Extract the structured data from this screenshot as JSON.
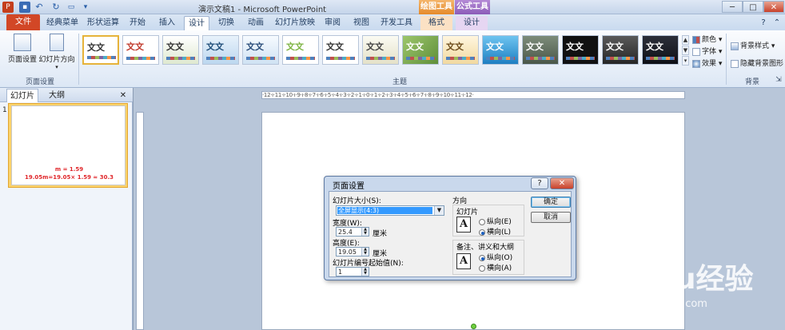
{
  "window": {
    "title": "演示文稿1 - Microsoft PowerPoint",
    "contextual_groups": [
      "绘图工具",
      "公式工具"
    ],
    "controls": [
      "─",
      "□",
      "✕"
    ]
  },
  "tabs": [
    "文件",
    "经典菜单",
    "形状运算",
    "开始",
    "插入",
    "设计",
    "切换",
    "动画",
    "幻灯片放映",
    "审阅",
    "视图",
    "开发工具",
    "格式",
    "设计"
  ],
  "ribbon": {
    "page_setup_group": {
      "label": "页面设置",
      "page_setup_btn": "页面设置",
      "orientation_btn": "幻灯片方向"
    },
    "themes_group": {
      "label": "主题",
      "theme_text": "文文"
    },
    "side_options": {
      "colors": "颜色",
      "fonts": "字体",
      "effects": "效果"
    },
    "background_group": {
      "label": "背景",
      "bg_styles": "背景样式",
      "hide_bg": "隐藏背景图形"
    }
  },
  "left_pane": {
    "tab_slides": "幻灯片",
    "tab_outline": "大纲",
    "close": "✕",
    "slide_number": "1",
    "thumb_line1": "m = 1.59",
    "thumb_line2": "19.05m=19.05× 1.59 ≈ 30.3"
  },
  "ruler": {
    "h_text": "·12·ı·11·ı·10·ı·9·ı·8·ı·7·ı·6·ı·5·ı·4·ı·3·ı·2·ı·1·ı·0·ı·1·ı·2·ı·3·ı·4·ı·5·ı·6·ı·7·ı·8·ı·9·ı·10·ı·11·ı·12·"
  },
  "dialog": {
    "title": "页面设置",
    "help": "?",
    "close": "✕",
    "slide_size_label": "幻灯片大小(S):",
    "slide_size_value": "全屏显示(4:3)",
    "width_label": "宽度(W):",
    "width_value": "25.4",
    "width_unit": "厘米",
    "height_label": "高度(E):",
    "height_value": "19.05",
    "height_unit": "厘米",
    "start_num_label": "幻灯片编号起始值(N):",
    "start_num_value": "1",
    "orientation_label": "方向",
    "slides_label": "幻灯片",
    "slides_portrait": "纵向(E)",
    "slides_landscape": "横向(L)",
    "notes_label": "备注、讲义和大纲",
    "notes_portrait": "纵向(O)",
    "notes_landscape": "横向(A)",
    "ok": "确定",
    "cancel": "取消"
  },
  "watermark": {
    "logo": "Baidu经验",
    "url": "jingyan.baidu.com"
  }
}
